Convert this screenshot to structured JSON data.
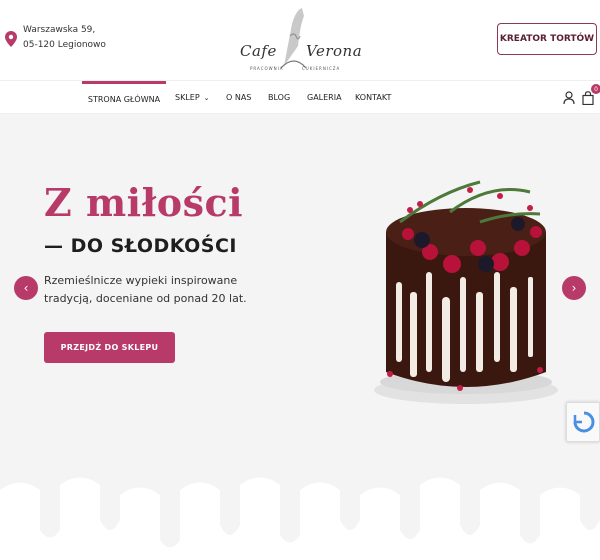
{
  "header": {
    "address_line1": "Warszawska 59,",
    "address_line2": "05-120 Legionowo",
    "logo_left": "Cafe",
    "logo_right": "Verona",
    "logo_sub_left": "PRACOWNIA",
    "logo_sub_right": "CUKIERNICZA",
    "kreator_label": "KREATOR TORTÓW"
  },
  "nav": {
    "items": [
      {
        "label": "STRONA GŁÓWNA"
      },
      {
        "label": "SKLEP"
      },
      {
        "label": "O NAS"
      },
      {
        "label": "BLOG"
      },
      {
        "label": "GALERIA"
      },
      {
        "label": "KONTAKT"
      }
    ],
    "cart_count": "0"
  },
  "hero": {
    "headline": "Z miłości",
    "subheadline": "— DO SŁODKOŚCI",
    "description": "Rzemieślnicze wypieki inspirowane tradycją, doceniane od ponad 20 lat.",
    "cta_label": "PRZEJDŹ DO SKLEPU"
  },
  "colors": {
    "accent": "#b83a68",
    "dark_accent": "#5a1e33",
    "hero_bg": "#f4f4f4"
  },
  "icons": {
    "location": "map-pin-icon",
    "user": "user-icon",
    "cart": "shopping-bag-icon",
    "prev": "chevron-left-icon",
    "next": "chevron-right-icon"
  }
}
